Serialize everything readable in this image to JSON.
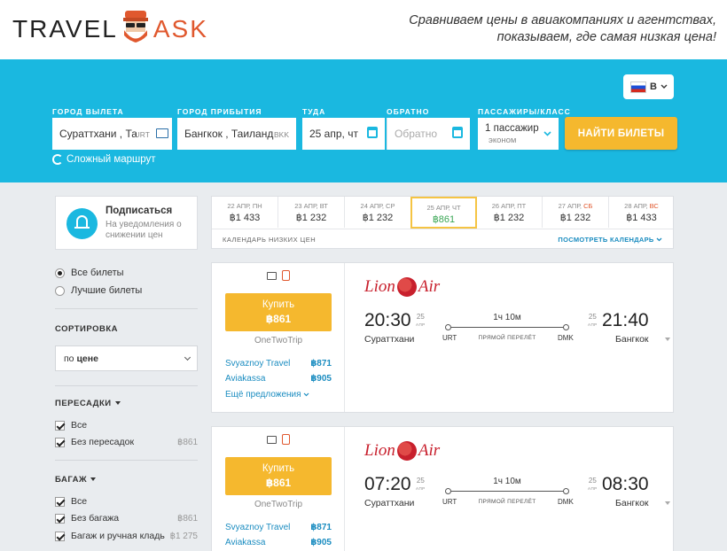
{
  "header": {
    "logo_left": "TRAVEL",
    "logo_right": "ASK",
    "tagline_line1": "Сравниваем цены в авиакомпаниях и агентствах,",
    "tagline_line2": "показываем, где самая низкая цена!"
  },
  "search": {
    "language": "В",
    "labels": {
      "from": "ГОРОД ВЫЛЕТА",
      "to": "ГОРОД ПРИБЫТИЯ",
      "depart": "ТУДА",
      "return": "ОБРАТНО",
      "passengers": "ПАССАЖИРЫ/КЛАСС"
    },
    "from_value": "Сураттхани , Та",
    "from_code": "URT",
    "to_value": "Бангкок , Таиланд",
    "to_code": "BKK",
    "depart_value": "25 апр, чт",
    "return_placeholder": "Обратно",
    "passengers_value": "1 пассажир",
    "class_value": "эконом",
    "submit_label": "НАЙТИ БИЛЕТЫ",
    "complex_route": "Сложный маршрут"
  },
  "subscribe": {
    "title": "Подписаться",
    "text": "На уведомления о снижении цен"
  },
  "calendar": {
    "days": [
      {
        "date": "22 АПР,",
        "wd": "ПН",
        "weekend": false,
        "price": "฿1 433"
      },
      {
        "date": "23 АПР,",
        "wd": "ВТ",
        "weekend": false,
        "price": "฿1 232"
      },
      {
        "date": "24 АПР,",
        "wd": "СР",
        "weekend": false,
        "price": "฿1 232"
      },
      {
        "date": "25 АПР,",
        "wd": "ЧТ",
        "weekend": false,
        "price": "฿861"
      },
      {
        "date": "26 АПР,",
        "wd": "ПТ",
        "weekend": false,
        "price": "฿1 232"
      },
      {
        "date": "27 АПР,",
        "wd": "СБ",
        "weekend": true,
        "price": "฿1 232"
      },
      {
        "date": "28 АПР,",
        "wd": "ВС",
        "weekend": true,
        "price": "฿1 433"
      }
    ],
    "footer_left": "КАЛЕНДАРЬ НИЗКИХ ЦЕН",
    "footer_right": "ПОСМОТРЕТЬ КАЛЕНДАРЬ"
  },
  "filters": {
    "all_tickets": "Все билеты",
    "best_tickets": "Лучшие билеты",
    "sort_title": "СОРТИРОВКА",
    "sort_prefix": "по",
    "sort_value": "цене",
    "transfers_title": "ПЕРЕСАДКИ",
    "transfers_all": "Все",
    "transfers_direct": "Без пересадок",
    "transfers_direct_price": "฿861",
    "baggage_title": "БАГАЖ",
    "baggage_all": "Все",
    "baggage_none": "Без багажа",
    "baggage_none_price": "฿861",
    "baggage_hand": "Багаж и ручная кладь",
    "baggage_hand_price": "฿1 275"
  },
  "tickets": [
    {
      "buy_label": "Купить",
      "price": "฿861",
      "agent": "OneTwoTrip",
      "offers": [
        {
          "name": "Svyaznoy Travel",
          "price": "฿871"
        },
        {
          "name": "Aviakassa",
          "price": "฿905"
        }
      ],
      "more_offers": "Ещё предложения",
      "airline_left": "Lion",
      "airline_right": "Air",
      "dep_time": "20:30",
      "dep_day": "25",
      "dep_month": "АПР",
      "dep_city": "Сураттхани",
      "dep_code": "URT",
      "duration": "1ч 10м",
      "direct": "ПРЯМОЙ ПЕРЕЛЁТ",
      "arr_time": "21:40",
      "arr_day": "25",
      "arr_month": "АПР",
      "arr_city": "Бангкок",
      "arr_code": "DMK"
    },
    {
      "buy_label": "Купить",
      "price": "฿861",
      "agent": "OneTwoTrip",
      "offers": [
        {
          "name": "Svyaznoy Travel",
          "price": "฿871"
        },
        {
          "name": "Aviakassa",
          "price": "฿905"
        }
      ],
      "airline_left": "Lion",
      "airline_right": "Air",
      "dep_time": "07:20",
      "dep_day": "25",
      "dep_month": "АПР",
      "dep_city": "Сураттхани",
      "dep_code": "URT",
      "duration": "1ч 10м",
      "direct": "ПРЯМОЙ ПЕРЕЛЁТ",
      "arr_time": "08:30",
      "arr_day": "25",
      "arr_month": "АПР",
      "arr_city": "Бангкок",
      "arr_code": "DMK"
    }
  ],
  "colors": {
    "brand_blue": "#1ab8e0",
    "cta_yellow": "#f5b82e",
    "logo_orange": "#e0582e",
    "airline_red": "#c8202d",
    "link_blue": "#1a8cc0"
  }
}
